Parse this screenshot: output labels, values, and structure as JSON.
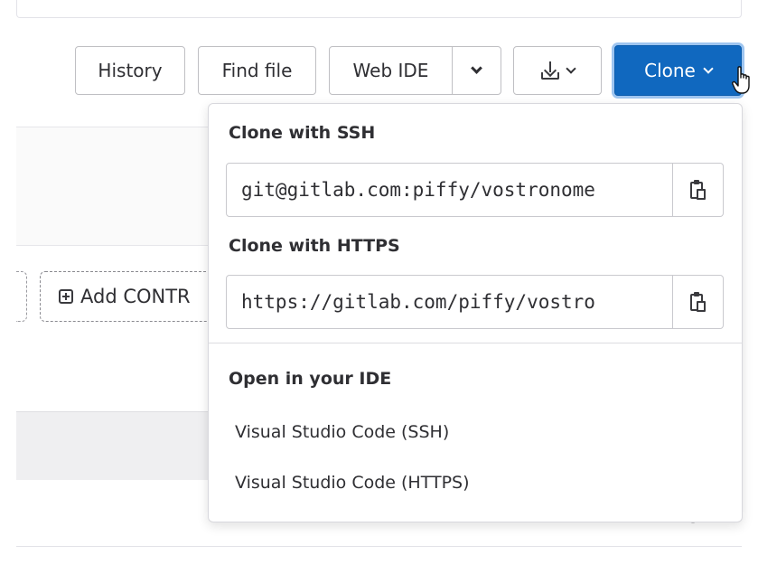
{
  "toolbar": {
    "history_label": "History",
    "find_file_label": "Find file",
    "web_ide_label": "Web IDE",
    "clone_label": "Clone",
    "accent_color": "#1068bf"
  },
  "background": {
    "add_button_label": "Add CONTR"
  },
  "clone_dropdown": {
    "ssh_heading": "Clone with SSH",
    "ssh_url": "git@gitlab.com:piffy/vostronome",
    "https_heading": "Clone with HTTPS",
    "https_url": "https://gitlab.com/piffy/vostro",
    "ide_heading": "Open in your IDE",
    "ide_items": [
      {
        "label": "Visual Studio Code (SSH)"
      },
      {
        "label": "Visual Studio Code (HTTPS)"
      }
    ]
  },
  "icons": {
    "download": "download-icon",
    "copy": "clipboard-icon",
    "caret": "chevron-down-icon",
    "add": "plus-square-icon",
    "cursor": "hand-pointer-icon"
  }
}
